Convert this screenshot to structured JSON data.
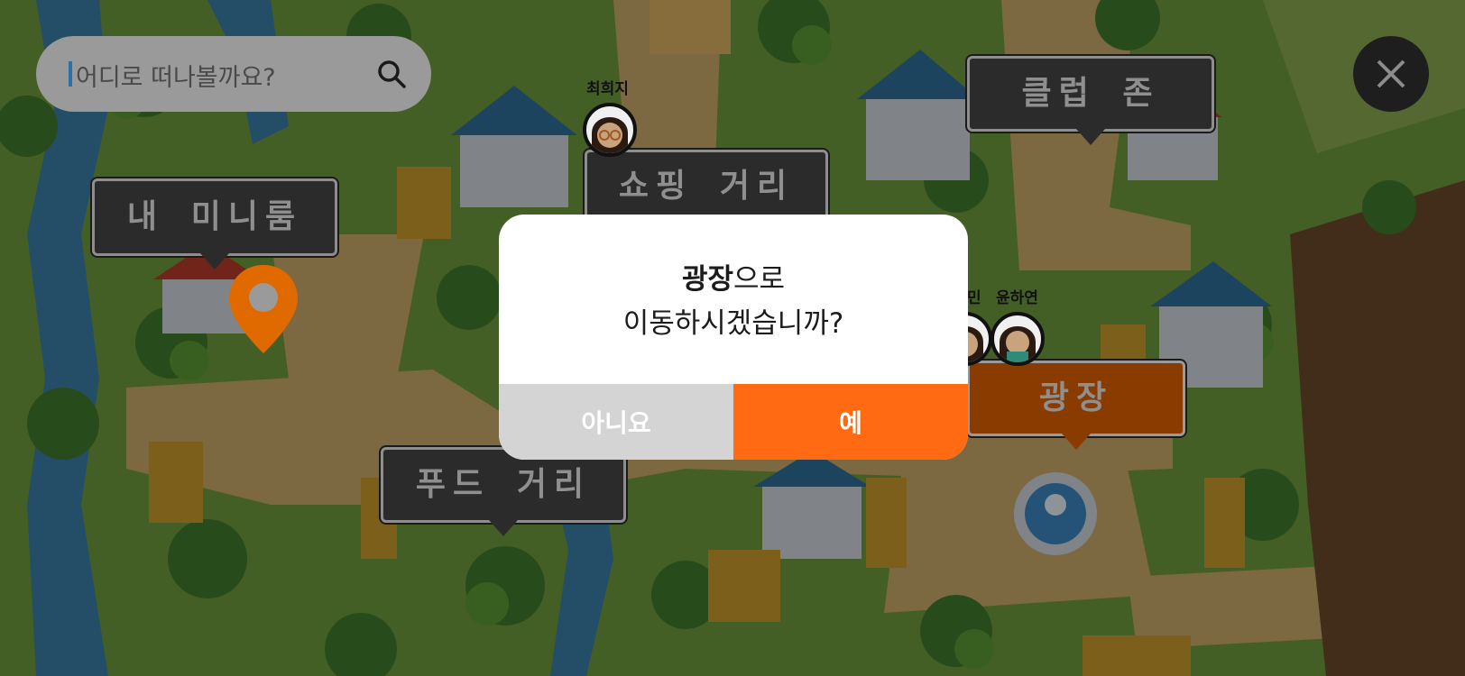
{
  "search": {
    "placeholder": "어디로 떠나볼까요?"
  },
  "signs": {
    "my_room": "내 미니룸",
    "shopping": "쇼핑 거리",
    "club": "클럽 존",
    "plaza": "광장",
    "food": "푸드 거리"
  },
  "players": {
    "p1": "최희지",
    "p2": "민",
    "p3": "윤하연"
  },
  "dialog": {
    "place": "광장",
    "suffix": "으로",
    "line2": "이동하시겠습니까?",
    "no_label": "아니요",
    "yes_label": "예"
  },
  "colors": {
    "accent": "#ff6a13",
    "pin": "#e06a00",
    "plaza_sign": "#8a3c00"
  },
  "icons": [
    "search-icon",
    "close-icon",
    "location-pin-icon"
  ]
}
